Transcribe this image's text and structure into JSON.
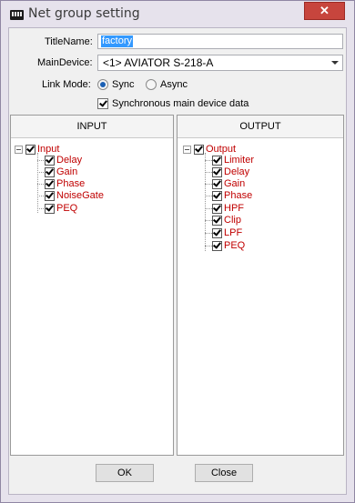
{
  "window": {
    "title": "Net group setting",
    "close_label": "✕"
  },
  "form": {
    "title_name_label": "TitleName:",
    "title_name_value": "factory",
    "main_device_label": "MainDevice:",
    "main_device_value": "<1> AVIATOR S-218-A",
    "link_mode_label": "Link Mode:",
    "link_mode_options": [
      "Sync",
      "Async"
    ],
    "link_mode_selected": "Sync",
    "sync_checkbox_label": "Synchronous main device data",
    "sync_checkbox_checked": true
  },
  "input_panel": {
    "header": "INPUT",
    "root": "Input",
    "items": [
      "Delay",
      "Gain",
      "Phase",
      "NoiseGate",
      "PEQ"
    ]
  },
  "output_panel": {
    "header": "OUTPUT",
    "root": "Output",
    "items": [
      "Limiter",
      "Delay",
      "Gain",
      "Phase",
      "HPF",
      "Clip",
      "LPF",
      "PEQ"
    ]
  },
  "buttons": {
    "ok_label": "OK",
    "close_label": "Close"
  },
  "colors": {
    "tree_text": "#c00000",
    "selection": "#3399ff",
    "close_button": "#c7453d"
  }
}
